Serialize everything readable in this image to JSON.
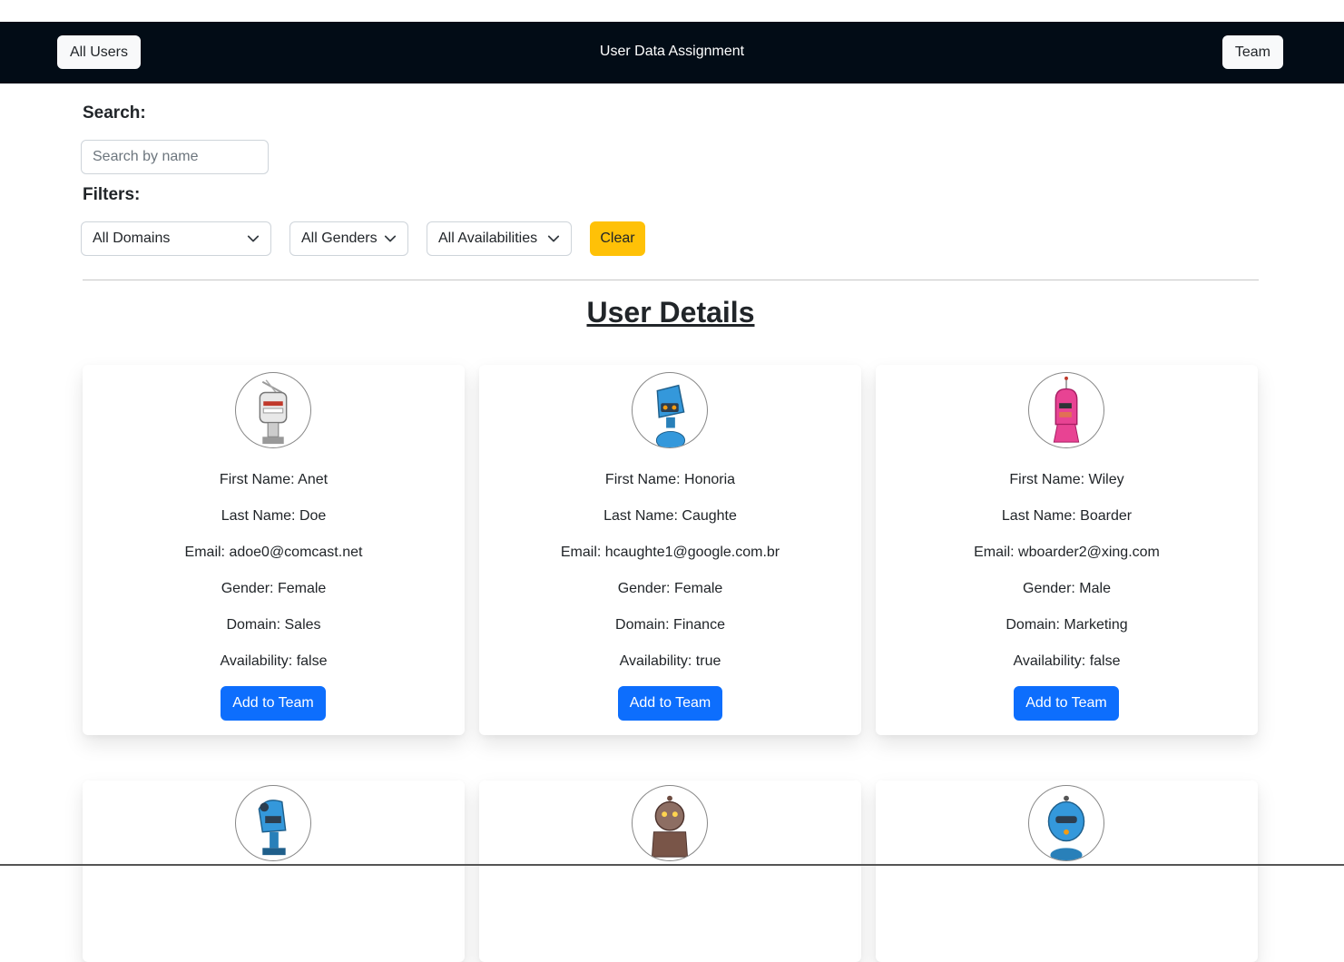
{
  "navbar": {
    "left_button": "All Users",
    "title": "User Data Assignment",
    "right_button": "Team"
  },
  "search": {
    "label": "Search:",
    "placeholder": "Search by name",
    "value": ""
  },
  "filters": {
    "label": "Filters:",
    "domain": "All Domains",
    "gender": "All Genders",
    "availability": "All Availabilities",
    "clear_label": "Clear"
  },
  "section_title": "User Details",
  "add_button_label": "Add to Team",
  "users": [
    {
      "first": "First Name: Anet",
      "last": "Last Name: Doe",
      "email": "Email: adoe0@comcast.net",
      "gender": "Gender: Female",
      "domain": "Domain: Sales",
      "availability": "Availability: false",
      "avatar": "robot-avatar-white"
    },
    {
      "first": "First Name: Honoria",
      "last": "Last Name: Caughte",
      "email": "Email: hcaughte1@google.com.br",
      "gender": "Gender: Female",
      "domain": "Domain: Finance",
      "availability": "Availability: true",
      "avatar": "robot-avatar-blue"
    },
    {
      "first": "First Name: Wiley",
      "last": "Last Name: Boarder",
      "email": "Email: wboarder2@xing.com",
      "gender": "Gender: Male",
      "domain": "Domain: Marketing",
      "availability": "Availability: false",
      "avatar": "robot-avatar-pink"
    },
    {
      "avatar": "robot-avatar-blue"
    },
    {
      "avatar": "robot-avatar-brown"
    },
    {
      "avatar": "robot-avatar-blue-round"
    }
  ],
  "colors": {
    "navbar_bg": "#020c16",
    "primary": "#0d6efd",
    "warning": "#ffc107"
  }
}
